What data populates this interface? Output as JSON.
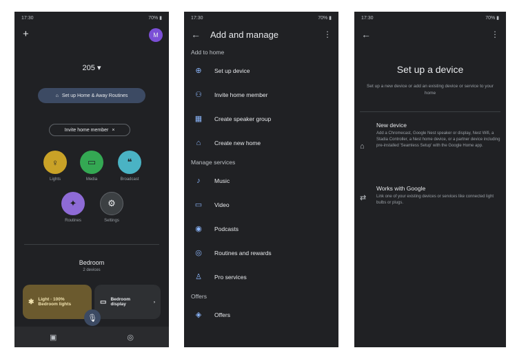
{
  "status": {
    "time": "17:30",
    "right": "70% ▮"
  },
  "screen1": {
    "home_name": "205",
    "chevron": "▾",
    "banner": "Set up Home & Away Routines",
    "invite_chip": "Invite home member",
    "actions": [
      {
        "label": "Lights",
        "icon": "bulb-icon",
        "color": "#c9a227"
      },
      {
        "label": "Media",
        "icon": "tv-icon",
        "color": "#34a853"
      },
      {
        "label": "Broadcast",
        "icon": "broadcast-icon",
        "color": "#4ab3c4"
      },
      {
        "label": "Routines",
        "icon": "routines-icon",
        "color": "#8e6bd6"
      },
      {
        "label": "Settings",
        "icon": "gear-icon",
        "color": "#3c4043"
      }
    ],
    "room_title": "Bedroom",
    "room_sub": "2 devices",
    "device_card_1": {
      "line1": "Light · 100%",
      "line2": "Bedroom lights"
    },
    "device_card_2": {
      "line1": "Bedroom",
      "line2": "display"
    }
  },
  "screen2": {
    "title": "Add and manage",
    "sections": [
      {
        "header": "Add to home",
        "items": [
          "Set up device",
          "Invite home member",
          "Create speaker group",
          "Create new home"
        ]
      },
      {
        "header": "Manage services",
        "items": [
          "Music",
          "Video",
          "Podcasts",
          "Routines and rewards",
          "Pro services"
        ]
      },
      {
        "header": "Offers",
        "items": [
          "Offers"
        ]
      }
    ]
  },
  "screen3": {
    "title": "Set up a device",
    "subtitle": "Set up a new device or add an existing device or service to your home",
    "options": [
      {
        "title": "New device",
        "desc": "Add a Chromecast, Google Nest speaker or display, Nest Wifi, a Stadia Controller, a Nest home device, or a partner device including pre-installed 'Seamless Setup' with the Google Home app."
      },
      {
        "title": "Works with Google",
        "desc": "Link one of your existing devices or services like connected light bulbs or plugs."
      }
    ]
  },
  "colors": {
    "background": "#202124",
    "accent": "#8ab4f8",
    "avatar": "#7b4fd6"
  }
}
